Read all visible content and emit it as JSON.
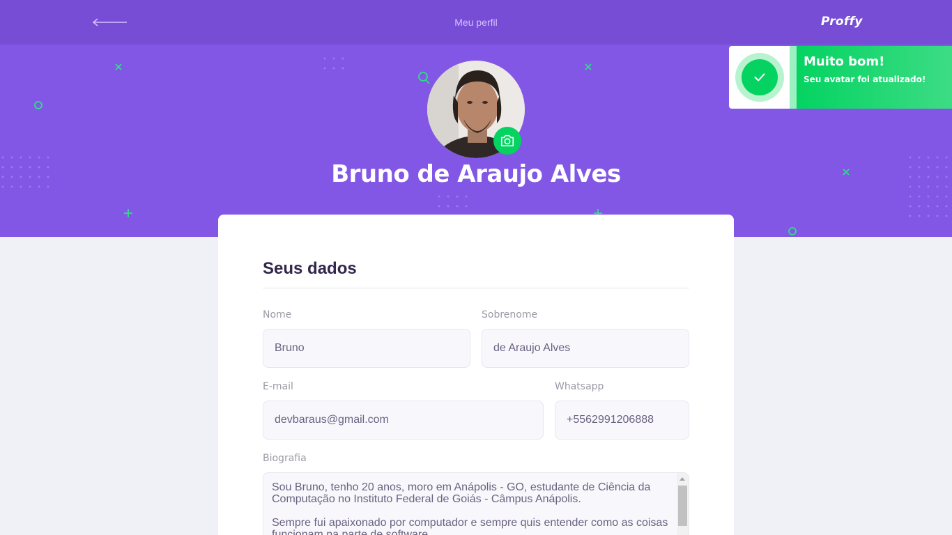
{
  "header": {
    "back_icon": "arrow-left-icon",
    "title": "Meu perfil",
    "brand": "Proffy"
  },
  "profile": {
    "name": "Bruno de Araujo Alves",
    "camera_icon": "camera-icon"
  },
  "toast": {
    "icon": "check-icon",
    "title": "Muito bom!",
    "message": "Seu avatar foi atualizado!"
  },
  "form": {
    "section_title": "Seus dados",
    "nome": {
      "label": "Nome",
      "value": "Bruno"
    },
    "sobrenome": {
      "label": "Sobrenome",
      "value": "de Araujo Alves"
    },
    "email": {
      "label": "E-mail",
      "value": "devbaraus@gmail.com"
    },
    "whatsapp": {
      "label": "Whatsapp",
      "value": "+5562991206888"
    },
    "biografia": {
      "label": "Biografia",
      "value": "Sou Bruno, tenho 20 anos, moro em Anápolis - GO, estudante de Ciência da Computação no Instituto Federal de Goiás - Câmpus Anápolis.\n\nSempre fui apaixonado por computador e sempre quis entender como as coisas funcionam na parte de software."
    }
  },
  "colors": {
    "primary": "#8257e5",
    "primary_dark": "#774dd6",
    "secondary": "#04d361",
    "background": "#f0f0f7"
  }
}
